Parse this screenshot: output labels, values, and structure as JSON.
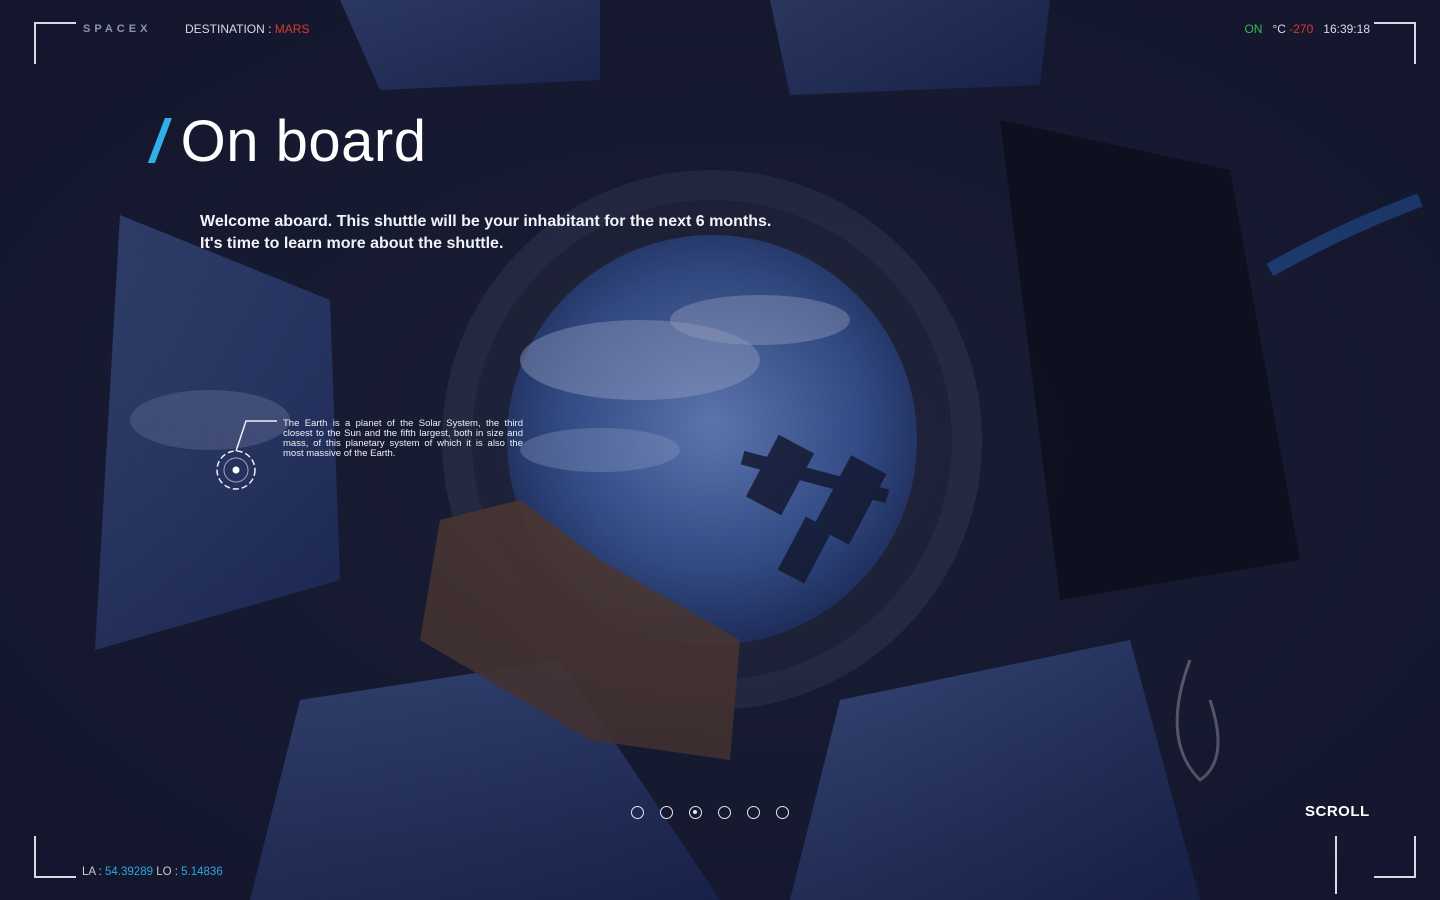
{
  "header": {
    "logo": "SPACEX",
    "destination_label": "DESTINATION :",
    "destination_value": "MARS",
    "status_on": "ON",
    "temp_unit": "°C",
    "temp_value": "-270",
    "time": "16:39:18"
  },
  "hero": {
    "slash": "/",
    "title": "On board",
    "intro_line1": "Welcome aboard. This shuttle will be your inhabitant for the next 6 months.",
    "intro_line2": "It's time to learn more about the shuttle."
  },
  "hotspot": {
    "note": "The Earth is a planet of the Solar System, the third closest to the Sun and the fifth largest, both in size and mass, of this planetary system of which it is also the most massive of the Earth."
  },
  "pagination": {
    "count": 6,
    "active_index": 3
  },
  "footer": {
    "la_label": "LA :",
    "la_value": "54.39289",
    "lo_label": "LO :",
    "lo_value": "5.14836",
    "scroll_label": "SCROLL"
  },
  "colors": {
    "accent_blue": "#33aee6",
    "alert_red": "#d8392e",
    "status_green": "#2fbf4f"
  }
}
